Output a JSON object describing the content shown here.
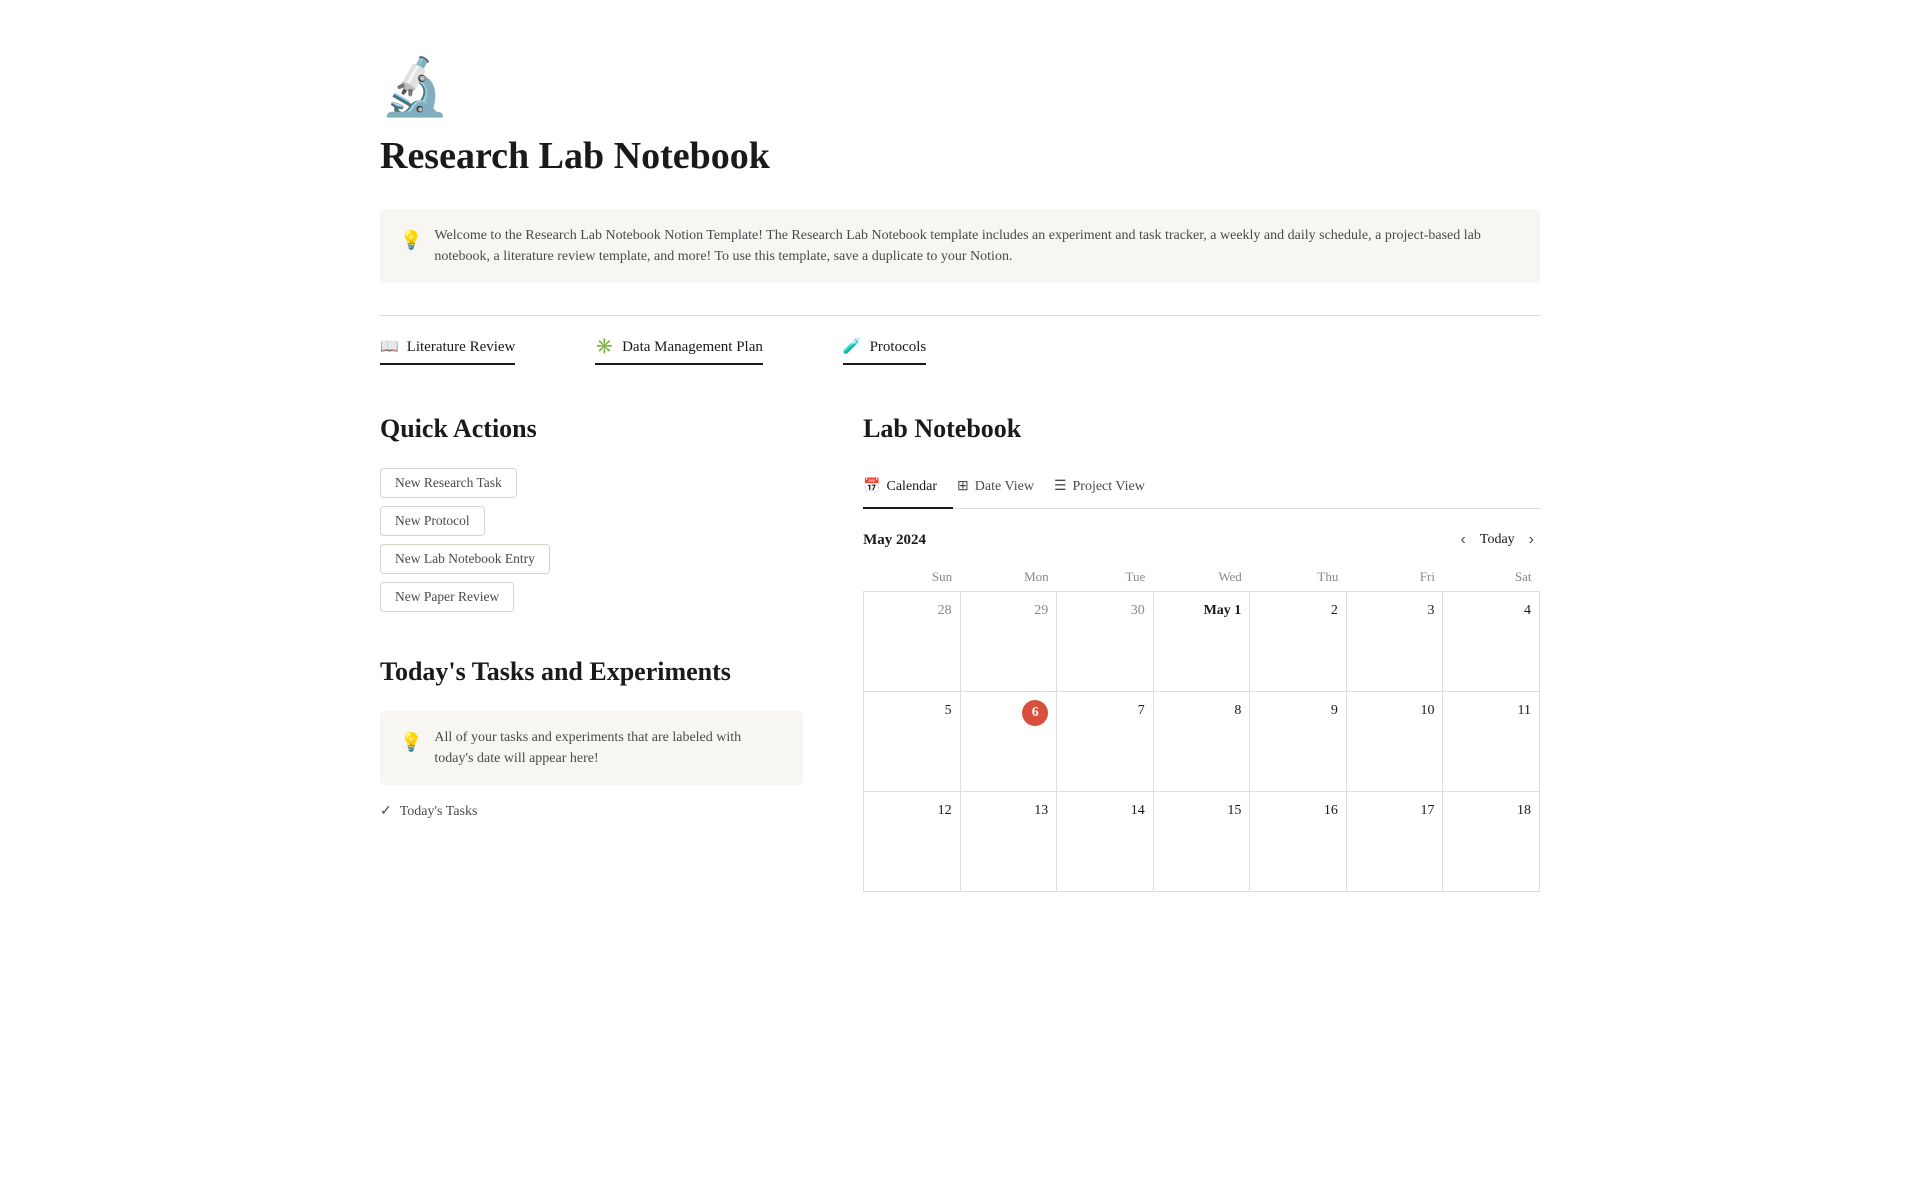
{
  "page": {
    "icon": "🔬",
    "title": "Research Lab Notebook",
    "info_box": {
      "icon": "💡",
      "text": "Welcome to the Research Lab Notebook Notion Template!  The Research Lab Notebook template includes an experiment and task tracker, a weekly and daily schedule, a project-based lab notebook, a literature review template, and more! To use this template, save a duplicate to your Notion."
    }
  },
  "nav": {
    "links": [
      {
        "id": "literature-review",
        "icon": "📖",
        "label": "Literature Review"
      },
      {
        "id": "data-management-plan",
        "icon": "✳️",
        "label": "Data Management Plan"
      },
      {
        "id": "protocols",
        "icon": "🧪",
        "label": "Protocols"
      }
    ]
  },
  "quick_actions": {
    "title": "Quick Actions",
    "buttons": [
      {
        "id": "new-research-task",
        "label": "New Research Task"
      },
      {
        "id": "new-protocol",
        "label": "New Protocol"
      },
      {
        "id": "new-lab-notebook-entry",
        "label": "New Lab Notebook Entry"
      },
      {
        "id": "new-paper-review",
        "label": "New Paper Review"
      }
    ]
  },
  "tasks": {
    "title": "Today's Tasks and Experiments",
    "info_icon": "💡",
    "info_text": "All of your tasks and experiments that are labeled with today's date will appear here!",
    "today_tasks_label": "Today's Tasks"
  },
  "lab_notebook": {
    "title": "Lab Notebook",
    "tabs": [
      {
        "id": "calendar",
        "icon": "📅",
        "label": "Calendar",
        "active": true
      },
      {
        "id": "date-view",
        "icon": "⊞",
        "label": "Date View",
        "active": false
      },
      {
        "id": "project-view",
        "icon": "☰",
        "label": "Project View",
        "active": false
      }
    ],
    "calendar": {
      "month": "May 2024",
      "today_label": "Today",
      "days_of_week": [
        "Sun",
        "Mon",
        "Tue",
        "Wed",
        "Thu",
        "Fri",
        "Sat"
      ],
      "weeks": [
        [
          {
            "day": "28",
            "current": false
          },
          {
            "day": "29",
            "current": false
          },
          {
            "day": "30",
            "current": false
          },
          {
            "day": "May 1",
            "current": true,
            "bold": true
          },
          {
            "day": "2",
            "current": true
          },
          {
            "day": "3",
            "current": true
          },
          {
            "day": "4",
            "current": true
          }
        ],
        [
          {
            "day": "5",
            "current": true
          },
          {
            "day": "6",
            "current": true,
            "today": true
          },
          {
            "day": "7",
            "current": true
          },
          {
            "day": "8",
            "current": true
          },
          {
            "day": "9",
            "current": true
          },
          {
            "day": "10",
            "current": true
          },
          {
            "day": "11",
            "current": true
          }
        ],
        [
          {
            "day": "12",
            "current": true
          },
          {
            "day": "13",
            "current": true
          },
          {
            "day": "14",
            "current": true
          },
          {
            "day": "15",
            "current": true
          },
          {
            "day": "16",
            "current": true
          },
          {
            "day": "17",
            "current": true
          },
          {
            "day": "18",
            "current": true
          }
        ]
      ]
    }
  }
}
